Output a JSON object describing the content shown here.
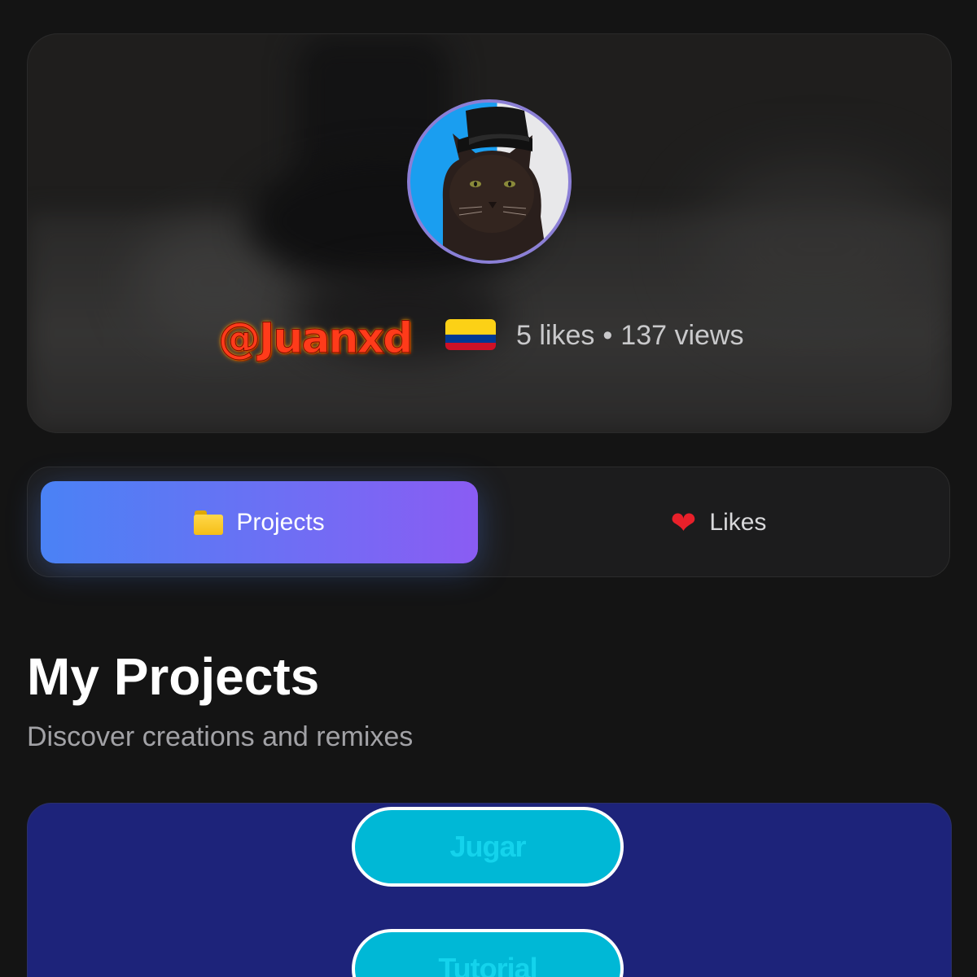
{
  "profile": {
    "username": "@Juanxd",
    "flag_country": "Colombia",
    "likes_text": "5 likes",
    "separator": "•",
    "views_text": "137 views",
    "avatar_description_icon": "cat-with-top-hat-avatar"
  },
  "tabs": [
    {
      "label": "Projects",
      "icon": "folder-icon",
      "active": true
    },
    {
      "label": "Likes",
      "icon": "heart-icon",
      "active": false
    }
  ],
  "section": {
    "title": "My Projects",
    "subtitle": "Discover creations and remixes"
  },
  "project_card": {
    "buttons": [
      {
        "label": "Jugar"
      },
      {
        "label": "Tutorial"
      }
    ]
  },
  "colors": {
    "background": "#141414",
    "tab_gradient_start": "#4a82f5",
    "tab_gradient_end": "#8a5cf3",
    "card_background": "#1d237a",
    "pill_button": "#00b8d6",
    "username_fire": "#ff3b1a"
  }
}
